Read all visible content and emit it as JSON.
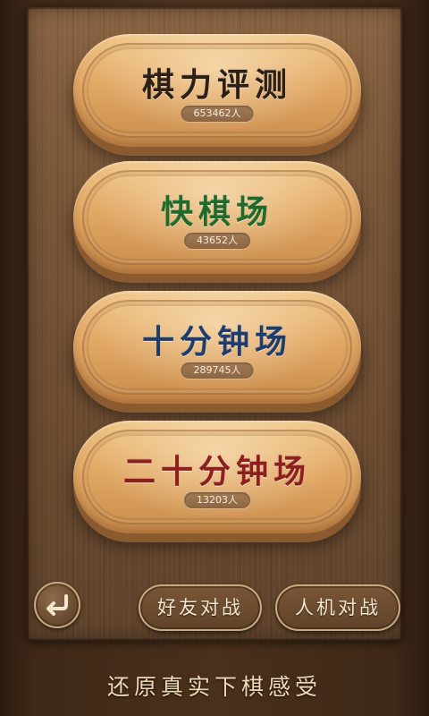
{
  "menu": {
    "items": [
      {
        "title": "棋力评测",
        "count": "653462人",
        "color": "#2c2016"
      },
      {
        "title": "快棋场",
        "count": "43652人",
        "color": "#1f6b2b"
      },
      {
        "title": "十分钟场",
        "count": "289745人",
        "color": "#1c3d6e"
      },
      {
        "title": "二十分钟场",
        "count": "13203人",
        "color": "#8e1f1f"
      }
    ]
  },
  "bottom_bar": {
    "back_icon": "back-arrow-icon",
    "friend_battle_label": "好友对战",
    "ai_battle_label": "人机对战"
  },
  "tagline": "还原真实下棋感受",
  "colors": {
    "wood_light": "#f0c689",
    "wood_dark": "#8b5a2e",
    "frame_bg": "#7a5738",
    "button_border": "#c9aa7c"
  }
}
